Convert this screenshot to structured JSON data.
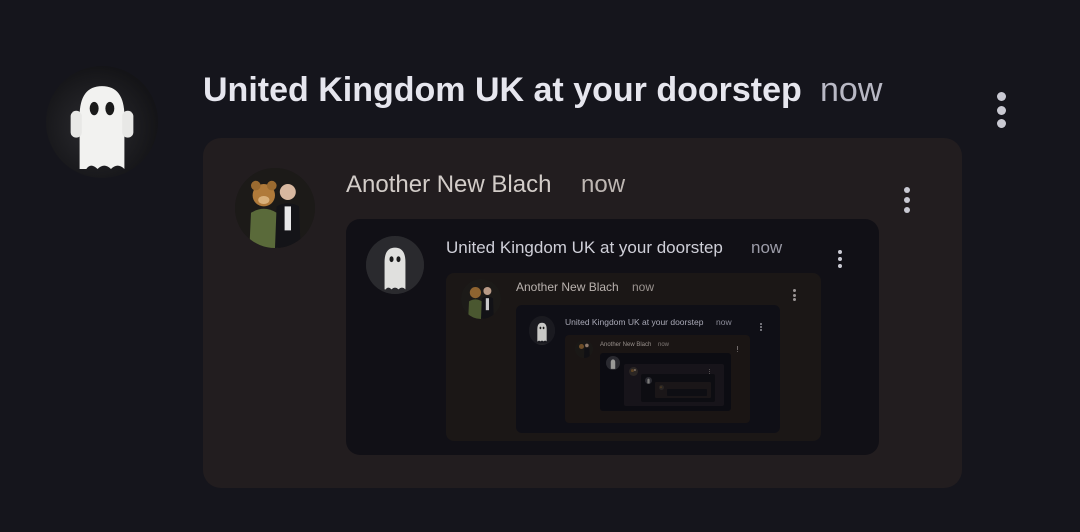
{
  "feed": {
    "levels": [
      {
        "author": "United Kingdom UK at your doorstep",
        "time": "now",
        "avatar_icon": "ghost-avatar-icon"
      },
      {
        "author": "Another New Blach",
        "time": "now",
        "avatar_icon": "mascot-photo-avatar-icon"
      },
      {
        "author": "United Kingdom UK at your doorstep",
        "time": "now",
        "avatar_icon": "ghost-avatar-icon"
      },
      {
        "author": "Another New Blach",
        "time": "now",
        "avatar_icon": "mascot-photo-avatar-icon"
      },
      {
        "author": "United Kingdom UK at your doorstep",
        "time": "now",
        "avatar_icon": "ghost-avatar-icon"
      },
      {
        "author": "Another New Blach",
        "time": "now",
        "avatar_icon": "mascot-photo-avatar-icon"
      },
      {
        "author": "",
        "time": "",
        "avatar_icon": "ghost-avatar-icon"
      },
      {
        "author": "",
        "time": "",
        "avatar_icon": "mascot-photo-avatar-icon"
      },
      {
        "author": "",
        "time": "",
        "avatar_icon": "ghost-avatar-icon"
      },
      {
        "author": "",
        "time": "",
        "avatar_icon": "mascot-photo-avatar-icon"
      }
    ]
  },
  "colors": {
    "background": "#15151c",
    "card_warm": "#221d1f",
    "card_cool": "#111016",
    "text_primary": "#e6e6ee",
    "text_secondary": "#9a9aa6"
  }
}
